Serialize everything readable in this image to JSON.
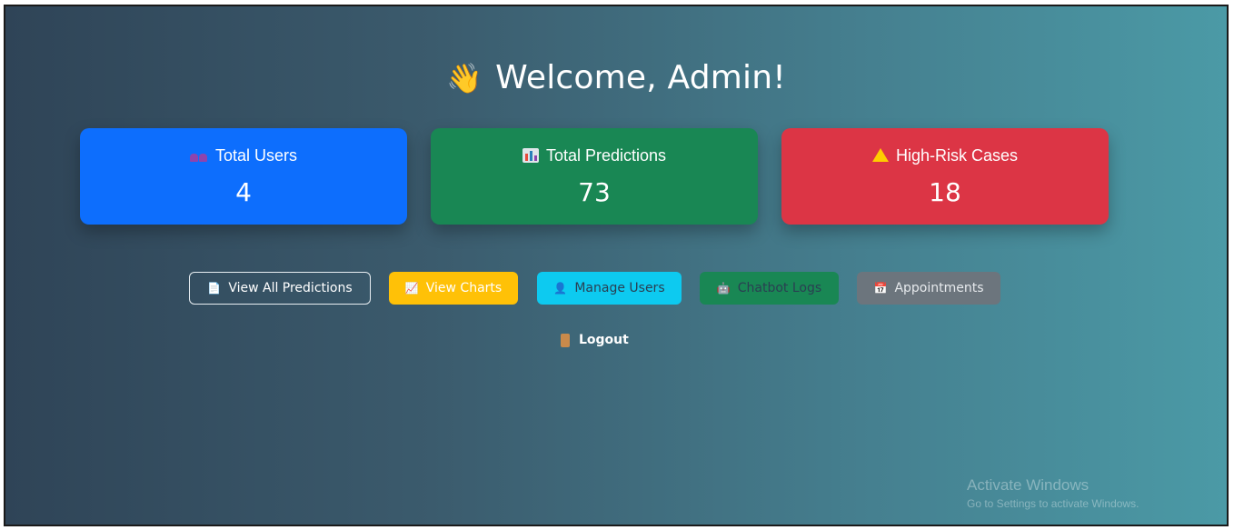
{
  "header": {
    "wave_icon": "👋",
    "title": "Welcome, Admin!"
  },
  "stats": [
    {
      "icon": "users-icon",
      "label": "Total Users",
      "value": "4",
      "color": "#0d6efd"
    },
    {
      "icon": "bar-chart-icon",
      "label": "Total Predictions",
      "value": "73",
      "color": "#198754"
    },
    {
      "icon": "warning-icon",
      "label": "High-Risk Cases",
      "value": "18",
      "color": "#dc3545"
    }
  ],
  "actions": {
    "view_predictions": {
      "icon": "📄",
      "label": "View All Predictions"
    },
    "view_charts": {
      "icon": "📈",
      "label": "View Charts"
    },
    "manage_users": {
      "icon": "👤",
      "label": "Manage Users"
    },
    "chatbot_logs": {
      "icon": "🤖",
      "label": "Chatbot Logs"
    },
    "appointments": {
      "icon": "📅",
      "label": "Appointments"
    }
  },
  "logout": {
    "label": "Logout"
  },
  "watermark": {
    "line1": "Activate Windows",
    "line2": "Go to Settings to activate Windows."
  }
}
